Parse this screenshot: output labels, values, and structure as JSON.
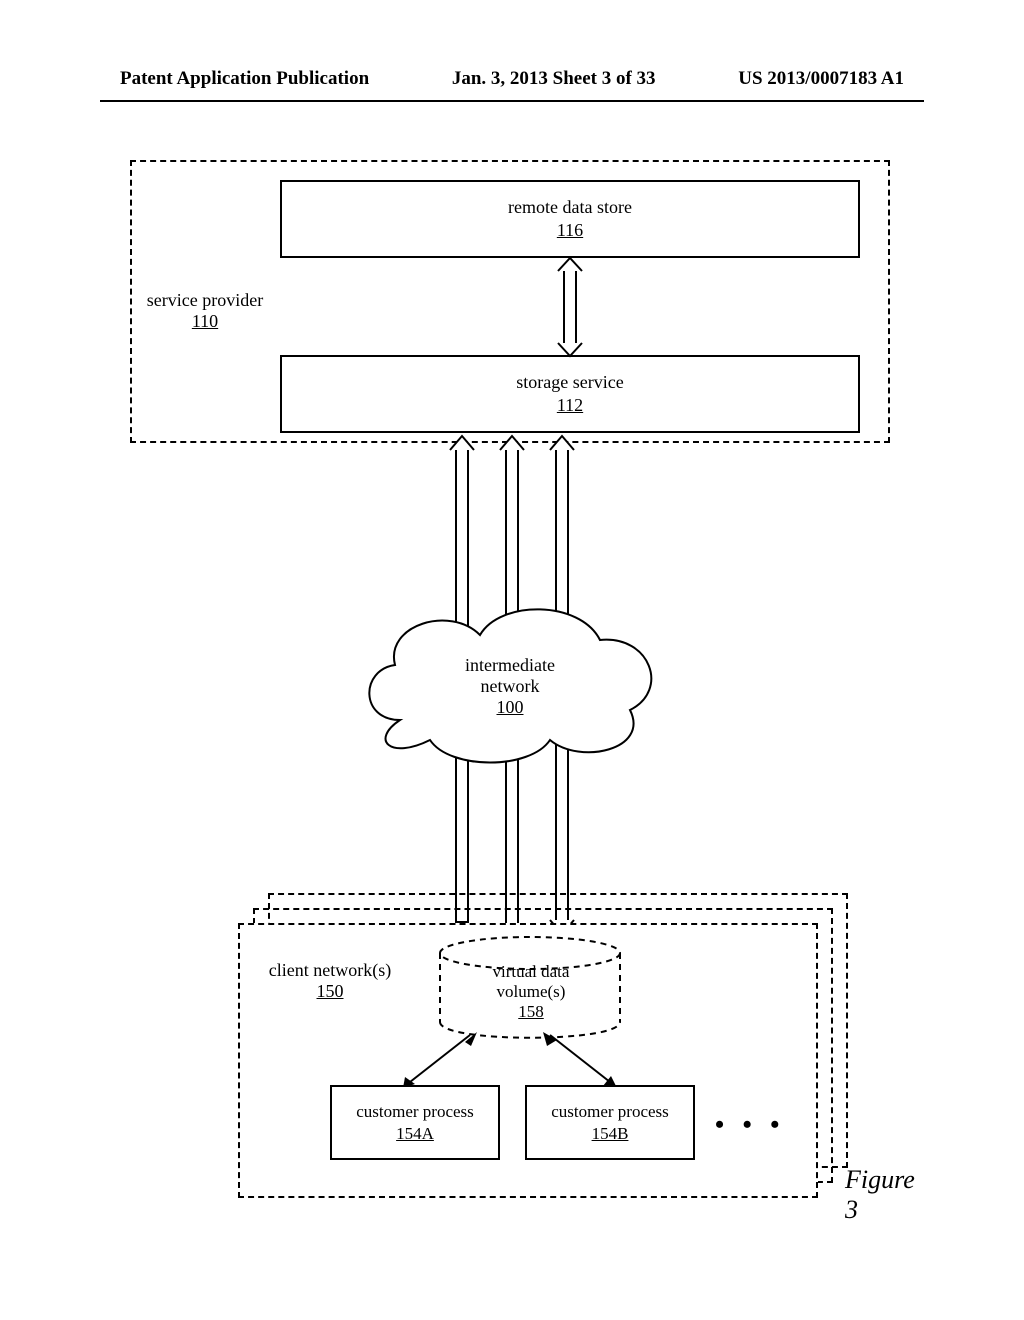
{
  "header": {
    "left": "Patent Application Publication",
    "center": "Jan. 3, 2013   Sheet 3 of 33",
    "right": "US 2013/0007183 A1"
  },
  "service_provider": {
    "label": "service provider",
    "ref": "110"
  },
  "remote_store": {
    "label": "remote data store",
    "ref": "116"
  },
  "storage_service": {
    "label": "storage service",
    "ref": "112"
  },
  "cloud": {
    "label1": "intermediate",
    "label2": "network",
    "ref": "100"
  },
  "client_net": {
    "label": "client network(s)",
    "ref": "150"
  },
  "vdv": {
    "label1": "virtual data",
    "label2": "volume(s)",
    "ref": "158"
  },
  "cust_a": {
    "label": "customer process",
    "ref": "154A"
  },
  "cust_b": {
    "label": "customer process",
    "ref": "154B"
  },
  "dots": "• • •",
  "figure": "Figure 3"
}
